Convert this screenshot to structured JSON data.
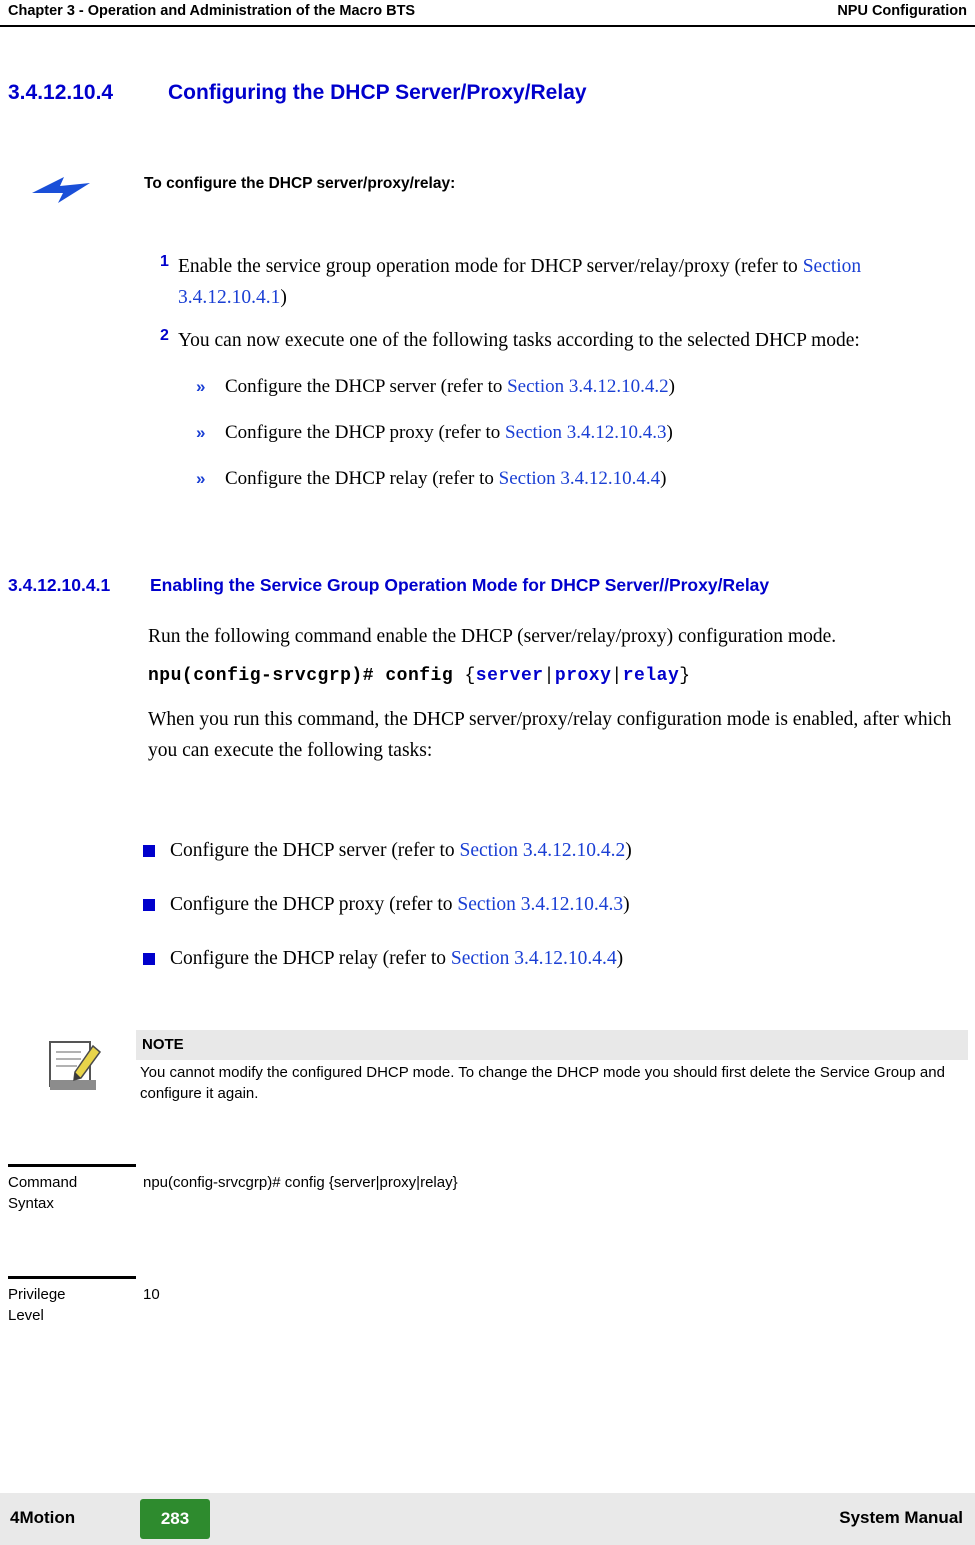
{
  "header": {
    "left": "Chapter 3 - Operation and Administration of the Macro BTS",
    "right": "NPU Configuration"
  },
  "section": {
    "number": "3.4.12.10.4",
    "title": "Configuring the DHCP Server/Proxy/Relay"
  },
  "callout": {
    "label": "To configure the DHCP server/proxy/relay:",
    "icon": "blue-arrow-icon"
  },
  "steps": [
    {
      "num": "1",
      "text_before": "Enable the service group operation mode for DHCP server/relay/proxy (refer to ",
      "link": "Section 3.4.12.10.4.1",
      "text_after": ")"
    },
    {
      "num": "2",
      "text_before": "You can now execute one of the following tasks according to the selected DHCP mode:",
      "link": "",
      "text_after": ""
    }
  ],
  "subbullets": [
    {
      "marker": "»",
      "before": "Configure the DHCP server (refer to ",
      "link": "Section 3.4.12.10.4.2",
      "after": ")"
    },
    {
      "marker": "»",
      "before": "Configure the DHCP proxy (refer to ",
      "link": "Section 3.4.12.10.4.3",
      "after": ")"
    },
    {
      "marker": "»",
      "before": "Configure the DHCP relay (refer to ",
      "link": "Section 3.4.12.10.4.4",
      "after": ")"
    }
  ],
  "subsection": {
    "number": "3.4.12.10.4.1",
    "title": "Enabling the Service Group Operation Mode for DHCP Server//Proxy/Relay"
  },
  "body": {
    "para1": "Run the following command enable the DHCP (server/relay/proxy) configuration mode.",
    "command": {
      "prompt": "npu(config-srvcgrp)# config",
      "open_brace": "{",
      "opt1": "server",
      "sep1": "|",
      "opt2": "proxy",
      "sep2": "|",
      "opt3": "relay",
      "close_brace": "}"
    },
    "para2": "When you run this command, the DHCP server/proxy/relay configuration mode is enabled, after which you can execute the following tasks:"
  },
  "square_bullets": [
    {
      "before": "Configure the DHCP server (refer to ",
      "link": "Section 3.4.12.10.4.2",
      "after": ")"
    },
    {
      "before": "Configure the DHCP proxy (refer to ",
      "link": "Section 3.4.12.10.4.3",
      "after": ")"
    },
    {
      "before": "Configure the DHCP relay (refer to ",
      "link": "Section 3.4.12.10.4.4",
      "after": ")"
    }
  ],
  "note": {
    "title": "NOTE",
    "icon": "note-pencil-icon",
    "text": "You cannot modify the configured DHCP mode. To change the DHCP mode you should first delete the Service Group and configure it again."
  },
  "command_table": [
    {
      "label_line1": "Command",
      "label_line2": "Syntax",
      "value": "npu(config-srvcgrp)# config {server|proxy|relay}"
    },
    {
      "label_line1": "Privilege",
      "label_line2": "Level",
      "value": "10"
    }
  ],
  "footer": {
    "left": "4Motion",
    "page": "283",
    "right": "System Manual"
  },
  "colors": {
    "heading_blue": "#0000cc",
    "link_blue": "#1a3fd4",
    "page_badge_green": "#2e8b2e",
    "note_header_grey": "#e8e8e8",
    "footer_grey": "#e9e9e9"
  }
}
